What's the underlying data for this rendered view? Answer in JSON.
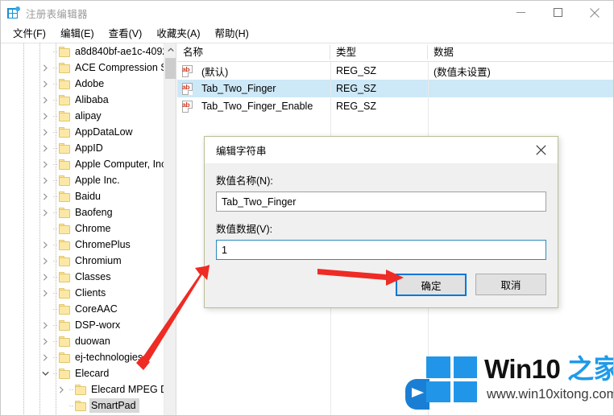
{
  "window": {
    "title": "注册表编辑器",
    "icon": "registry-editor-icon",
    "controls": {
      "minimize": "minimize-icon",
      "maximize": "maximize-icon",
      "close": "close-icon"
    }
  },
  "menubar": {
    "items": [
      {
        "label": "文件(F)"
      },
      {
        "label": "编辑(E)"
      },
      {
        "label": "查看(V)"
      },
      {
        "label": "收藏夹(A)"
      },
      {
        "label": "帮助(H)"
      }
    ]
  },
  "tree": {
    "nodes": [
      {
        "label": "a8d840bf-ae1c-4092",
        "expandable": false,
        "depth": 0,
        "selected": false
      },
      {
        "label": "ACE Compression S",
        "expandable": true,
        "depth": 0,
        "selected": false
      },
      {
        "label": "Adobe",
        "expandable": true,
        "depth": 0,
        "selected": false
      },
      {
        "label": "Alibaba",
        "expandable": true,
        "depth": 0,
        "selected": false
      },
      {
        "label": "alipay",
        "expandable": true,
        "depth": 0,
        "selected": false
      },
      {
        "label": "AppDataLow",
        "expandable": true,
        "depth": 0,
        "selected": false
      },
      {
        "label": "AppID",
        "expandable": true,
        "depth": 0,
        "selected": false
      },
      {
        "label": "Apple Computer, Inc",
        "expandable": true,
        "depth": 0,
        "selected": false
      },
      {
        "label": "Apple Inc.",
        "expandable": true,
        "depth": 0,
        "selected": false
      },
      {
        "label": "Baidu",
        "expandable": true,
        "depth": 0,
        "selected": false
      },
      {
        "label": "Baofeng",
        "expandable": true,
        "depth": 0,
        "selected": false
      },
      {
        "label": "Chrome",
        "expandable": false,
        "depth": 0,
        "selected": false
      },
      {
        "label": "ChromePlus",
        "expandable": true,
        "depth": 0,
        "selected": false
      },
      {
        "label": "Chromium",
        "expandable": true,
        "depth": 0,
        "selected": false
      },
      {
        "label": "Classes",
        "expandable": true,
        "depth": 0,
        "selected": false
      },
      {
        "label": "Clients",
        "expandable": true,
        "depth": 0,
        "selected": false
      },
      {
        "label": "CoreAAC",
        "expandable": false,
        "depth": 0,
        "selected": false
      },
      {
        "label": "DSP-worx",
        "expandable": true,
        "depth": 0,
        "selected": false
      },
      {
        "label": "duowan",
        "expandable": true,
        "depth": 0,
        "selected": false
      },
      {
        "label": "ej-technologies",
        "expandable": true,
        "depth": 0,
        "selected": false
      },
      {
        "label": "Elecard",
        "expandable": true,
        "expanded": true,
        "depth": 0,
        "selected": false
      },
      {
        "label": "Elecard MPEG De",
        "expandable": true,
        "depth": 1,
        "selected": false
      },
      {
        "label": "SmartPad",
        "expandable": false,
        "depth": 1,
        "selected": true
      }
    ],
    "scrollbar": {
      "up_arrow": "chevron-up-icon"
    }
  },
  "list": {
    "columns": [
      "名称",
      "类型",
      "数据"
    ],
    "rows": [
      {
        "name": "(默认)",
        "type": "REG_SZ",
        "data": "(数值未设置)",
        "selected": false
      },
      {
        "name": "Tab_Two_Finger",
        "type": "REG_SZ",
        "data": "",
        "selected": true
      },
      {
        "name": "Tab_Two_Finger_Enable",
        "type": "REG_SZ",
        "data": "",
        "selected": false
      }
    ],
    "value_icon": "ab"
  },
  "dialog": {
    "title": "编辑字符串",
    "close_icon": "close-icon",
    "name_label": "数值名称(N):",
    "name_value": "Tab_Two_Finger",
    "data_label": "数值数据(V):",
    "data_value": "1",
    "ok_label": "确定",
    "cancel_label": "取消"
  },
  "annotations": {
    "arrow_to_ok": "red-arrow-right",
    "arrow_to_value": "red-arrow-up-right",
    "color": "#ee2b24"
  },
  "watermark": {
    "brand_part1": "Win10 ",
    "brand_part2": "之家",
    "url": "www.win10xitong.com",
    "logo": "windows-logo-icon",
    "accent": "#2196e8"
  }
}
